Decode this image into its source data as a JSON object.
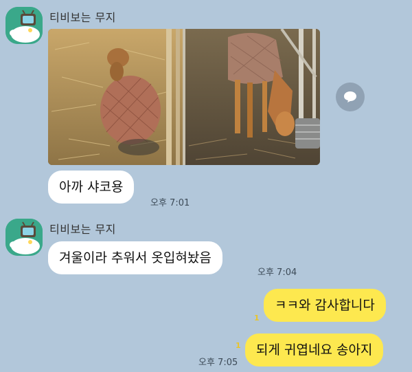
{
  "messages": [
    {
      "sender": "티비보는 무지"
    },
    {
      "text": "아까 샤코용",
      "time": "오후 7:01"
    },
    {
      "sender": "티비보는 무지",
      "text": "겨울이라 추워서 옷입혀놨음",
      "time": "오후 7:04"
    },
    {
      "text": "ㅋㅋ와 감사합니다",
      "unread": "1"
    },
    {
      "text": "되게 귀엽네요 송아지",
      "unread": "1",
      "time": "오후 7:05"
    }
  ],
  "icons": {
    "avatar": "muzi-tv-avatar-icon",
    "share": "share-speech-bubble-icon"
  },
  "colors": {
    "background": "#b2c7da",
    "my_bubble": "#fde84f",
    "other_bubble": "#ffffff"
  }
}
